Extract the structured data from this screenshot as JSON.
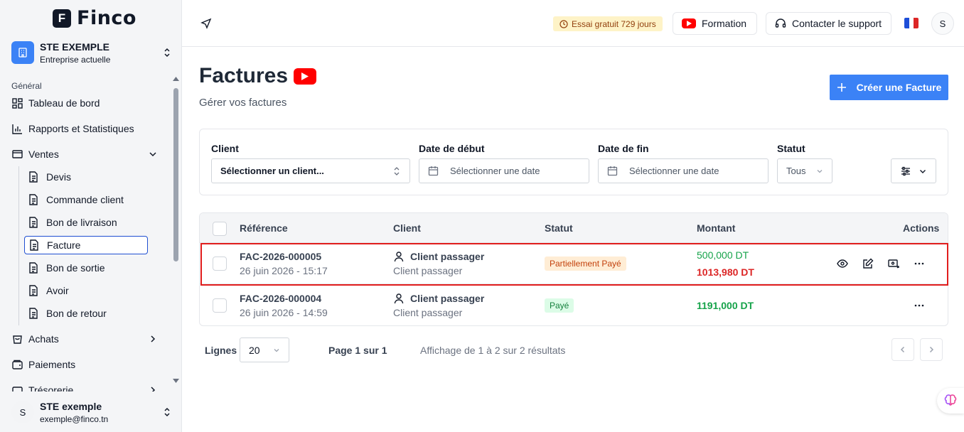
{
  "app": {
    "logo_text": "Finco",
    "logo_letter": "F"
  },
  "sidebar": {
    "company": {
      "name": "STE EXEMPLE",
      "subtitle": "Entreprise actuelle"
    },
    "section_label": "Général",
    "items": [
      {
        "label": "Tableau de bord",
        "icon": "dashboard-icon"
      },
      {
        "label": "Rapports et Statistiques",
        "icon": "bar-chart-icon"
      },
      {
        "label": "Ventes",
        "icon": "ventes-icon",
        "expanded": true
      },
      {
        "label": "Achats",
        "icon": "cart-icon"
      },
      {
        "label": "Paiements",
        "icon": "wallet-icon"
      },
      {
        "label": "Trésorerie",
        "icon": "treasury-icon"
      }
    ],
    "sub_items": [
      {
        "label": "Devis"
      },
      {
        "label": "Commande client"
      },
      {
        "label": "Bon de livraison"
      },
      {
        "label": "Facture",
        "active": true
      },
      {
        "label": "Bon de sortie"
      },
      {
        "label": "Avoir"
      },
      {
        "label": "Bon de retour"
      }
    ],
    "user": {
      "initial": "S",
      "name": "STE exemple",
      "email": "exemple@finco.tn"
    }
  },
  "topbar": {
    "trial_label": "Essai gratuit 729 jours",
    "formation_label": "Formation",
    "support_label": "Contacter le support",
    "avatar_initial": "S"
  },
  "page": {
    "title": "Factures",
    "subtitle": "Gérer vos factures",
    "create_label": "Créer une Facture"
  },
  "filters": {
    "client_label": "Client",
    "client_placeholder": "Sélectionner un client...",
    "start_label": "Date de début",
    "start_placeholder": "Sélectionner une date",
    "end_label": "Date de fin",
    "end_placeholder": "Sélectionner une date",
    "status_label": "Statut",
    "status_value": "Tous"
  },
  "table": {
    "columns": [
      "Référence",
      "Client",
      "Statut",
      "Montant",
      "Actions"
    ],
    "rows": [
      {
        "ref": "FAC-2026-000005",
        "date": "26 juin 2026 - 15:17",
        "client": "Client passager",
        "client_sub": "Client passager",
        "status": "Partiellement Payé",
        "paid": "500,000 DT",
        "due": "1013,980 DT"
      },
      {
        "ref": "FAC-2026-000004",
        "date": "26 juin 2026 - 14:59",
        "client": "Client passager",
        "client_sub": "Client passager",
        "status": "Payé",
        "amount": "1191,000 DT"
      }
    ]
  },
  "pagination": {
    "rows_label": "Lignes",
    "rows_value": "20",
    "page_text": "Page 1 sur 1",
    "summary": "Affichage de 1 à 2 sur 2 résultats"
  },
  "colors": {
    "accent": "#3b82f6",
    "paid_green": "#16a34a",
    "due_red": "#dc2626",
    "partial_badge_bg": "#ffedd5",
    "paid_badge_bg": "#dcfce7",
    "highlight": "#e11d1d"
  }
}
